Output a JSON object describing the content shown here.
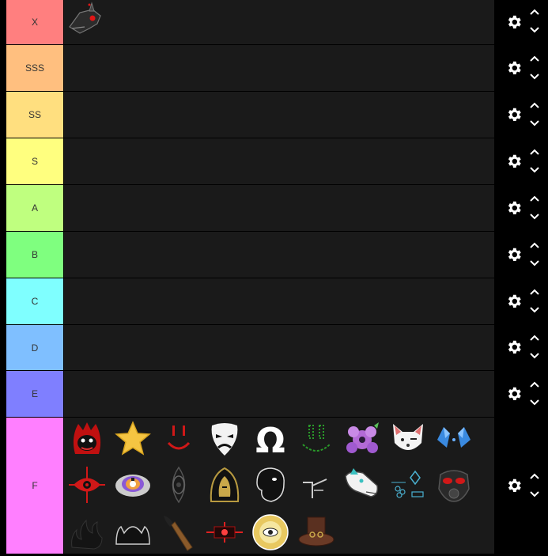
{
  "tiers": [
    {
      "label": "X",
      "color": "#ff7f7f"
    },
    {
      "label": "SSS",
      "color": "#ffbf7f"
    },
    {
      "label": "SS",
      "color": "#ffdf7f"
    },
    {
      "label": "S",
      "color": "#ffff7f"
    },
    {
      "label": "A",
      "color": "#bfff7f"
    },
    {
      "label": "B",
      "color": "#7fff7f"
    },
    {
      "label": "C",
      "color": "#7fffff"
    },
    {
      "label": "D",
      "color": "#7fbfff"
    },
    {
      "label": "E",
      "color": "#7f7fff"
    },
    {
      "label": "F",
      "color": "#ff7fff"
    }
  ],
  "x_items": [
    "dragon-head-icon"
  ],
  "f_items": [
    "red-flame-mask-icon",
    "star-icon",
    "red-smile-icon",
    "white-mask-icon",
    "omega-icon",
    "green-grin-icon",
    "flower-creature-icon",
    "white-fox-icon",
    "blue-crystal-icon",
    "red-eye-sigil-icon",
    "purple-bear-icon",
    "dark-eye-icon",
    "gold-hood-icon",
    "black-head-icon",
    "black-symbol-icon",
    "white-dragon-icon",
    "blue-circuit-icon",
    "gas-mask-icon",
    "black-flames-icon",
    "black-crown-icon",
    "paintbrush-icon",
    "red-burst-icon",
    "sun-eye-icon",
    "top-hat-icon"
  ],
  "controls": {
    "settings_icon": "gear-icon",
    "up_icon": "chevron-up-icon",
    "down_icon": "chevron-down-icon"
  }
}
